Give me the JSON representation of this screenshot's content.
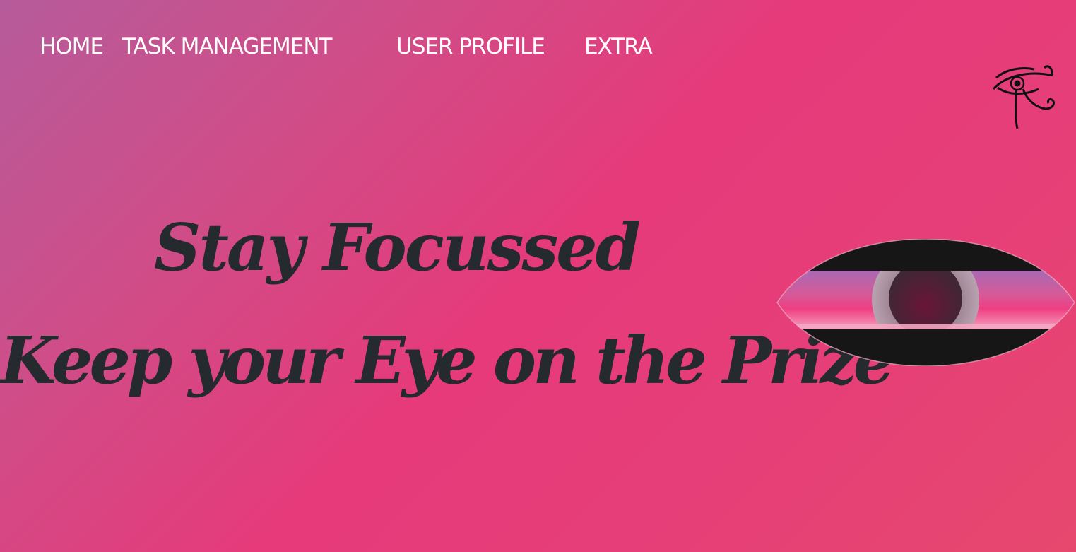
{
  "nav": {
    "items": [
      {
        "label": "HOME"
      },
      {
        "label": "TASK MANAGEMENT"
      },
      {
        "label": "USER PROFILE"
      },
      {
        "label": "EXTRA"
      }
    ]
  },
  "logo": {
    "icon": "eye-of-ra-icon"
  },
  "hero": {
    "line1": "Stay Focussed",
    "line2": "Keep your Eye on the Prize"
  },
  "eye_graphic": {
    "icon": "eye-icon"
  },
  "colors": {
    "text_dark": "#242a2d",
    "nav_text": "#ffffff",
    "bg_start": "#b65b9b",
    "bg_mid": "#e63a7a",
    "bg_end": "#e6486d"
  }
}
